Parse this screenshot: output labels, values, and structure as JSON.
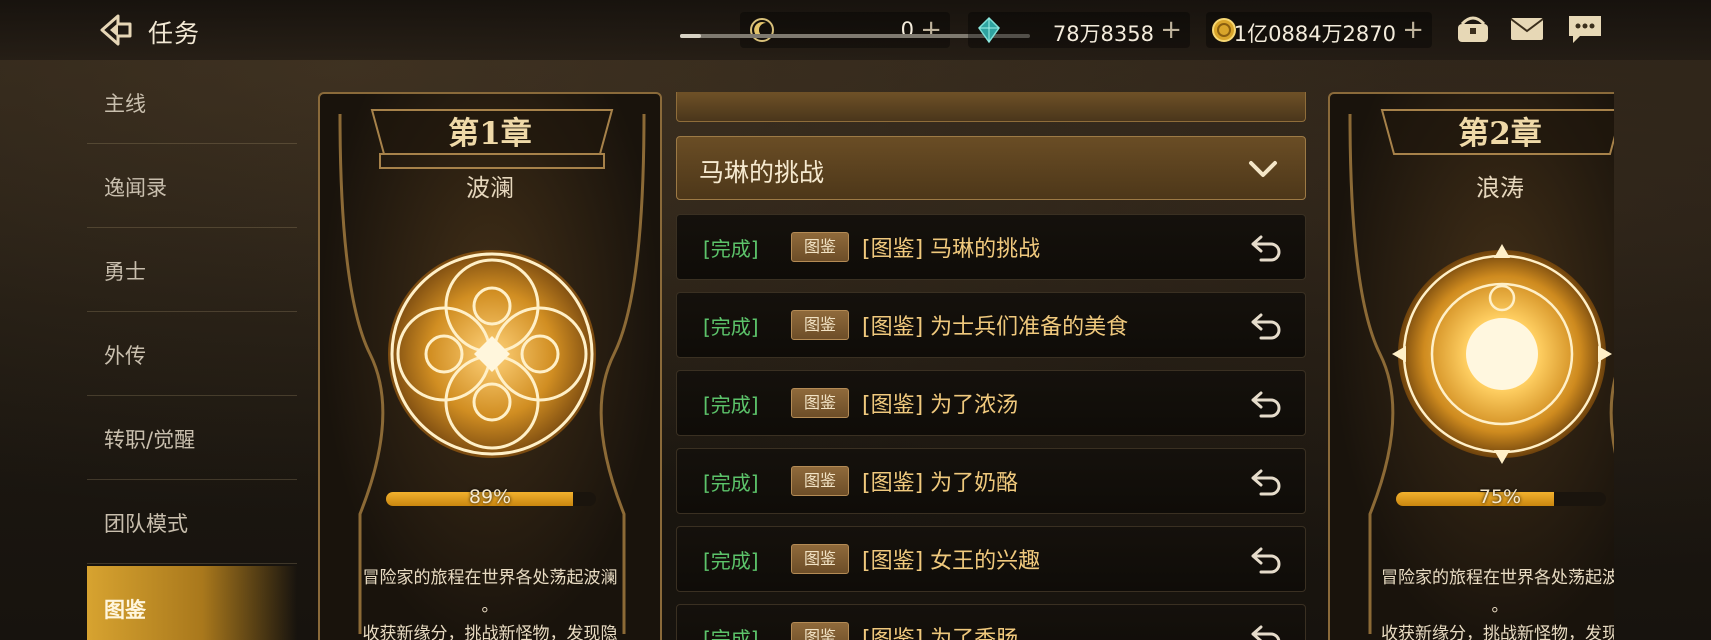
{
  "header": {
    "title": "任务",
    "resources": [
      {
        "icon": "crescent-coin-icon",
        "value": "0"
      },
      {
        "icon": "crystal-icon",
        "value": "78万8358"
      },
      {
        "icon": "gold-coin-icon",
        "value": "1亿0884万2870"
      }
    ],
    "plus": "+",
    "icons": [
      "treasure-chest-icon",
      "mail-icon",
      "chat-icon"
    ]
  },
  "sidebar": {
    "items": [
      {
        "label": "主线",
        "active": false
      },
      {
        "label": "逸闻录",
        "active": false
      },
      {
        "label": "勇士",
        "active": false
      },
      {
        "label": "外传",
        "active": false
      },
      {
        "label": "转职/觉醒",
        "active": false
      },
      {
        "label": "团队模式",
        "active": false
      },
      {
        "label": "图鉴",
        "active": true
      }
    ]
  },
  "chapters": [
    {
      "title": "第1章",
      "subtitle": "波澜",
      "progress": 89,
      "progress_label": "89%",
      "desc_line1": "冒险家的旅程在世界各处荡起波澜",
      "desc_line2": "。",
      "desc_line3": "收获新缘分，挑战新怪物，发现隐"
    },
    {
      "title": "第2章",
      "subtitle": "浪涛",
      "progress": 75,
      "progress_label": "75%",
      "desc_line1": "冒险家的旅程在世界各处荡起波",
      "desc_line2": "。",
      "desc_line3": "收获新缘分，挑战新怪物，发现"
    }
  ],
  "quest_group": {
    "title": "马琳的挑战",
    "expanded": true
  },
  "quests": [
    {
      "status": "[完成]",
      "tag": "图鉴",
      "name": "[图鉴] 马琳的挑战"
    },
    {
      "status": "[完成]",
      "tag": "图鉴",
      "name": "[图鉴] 为士兵们准备的美食"
    },
    {
      "status": "[完成]",
      "tag": "图鉴",
      "name": "[图鉴] 为了浓汤"
    },
    {
      "status": "[完成]",
      "tag": "图鉴",
      "name": "[图鉴] 为了奶酪"
    },
    {
      "status": "[完成]",
      "tag": "图鉴",
      "name": "[图鉴] 女王的兴趣"
    },
    {
      "status": "[完成]",
      "tag": "图鉴",
      "name": "[图鉴] 为了香肠"
    }
  ],
  "colors": {
    "accent_gold": "#d7a330",
    "complete_green": "#5cc36a",
    "quest_name": "#f0c97d"
  }
}
